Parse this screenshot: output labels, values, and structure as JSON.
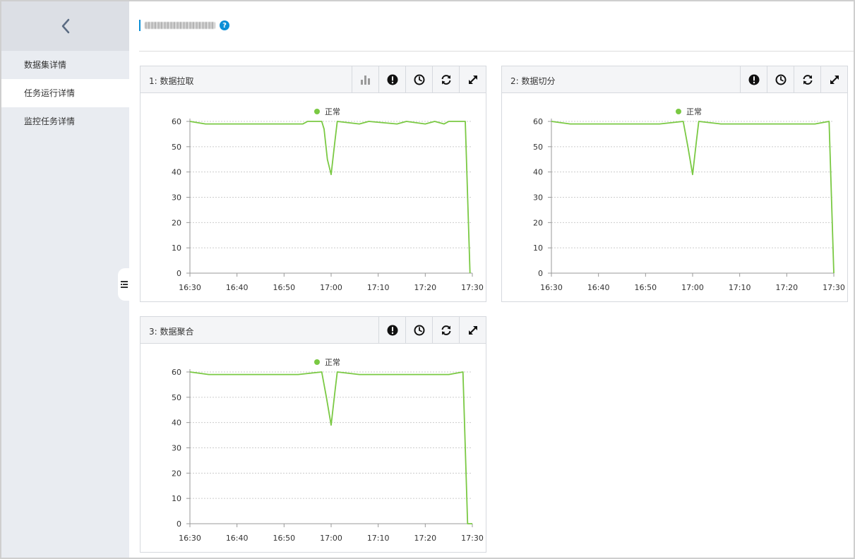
{
  "sidebar": {
    "items": [
      {
        "label": "数据集详情",
        "active": false
      },
      {
        "label": "任务运行详情",
        "active": true
      },
      {
        "label": "监控任务详情",
        "active": false
      }
    ]
  },
  "header": {
    "title": "",
    "help": "?"
  },
  "colors": {
    "accent": "#0a8fd6",
    "series": "#7ac943"
  },
  "panels": [
    {
      "title": "1: 数据拉取",
      "tools": [
        "bar-chart-icon",
        "alert-icon",
        "clock-icon",
        "refresh-icon",
        "expand-icon"
      ]
    },
    {
      "title": "2: 数据切分",
      "tools": [
        "alert-icon",
        "clock-icon",
        "refresh-icon",
        "expand-icon"
      ]
    },
    {
      "title": "3: 数据聚合",
      "tools": [
        "alert-icon",
        "clock-icon",
        "refresh-icon",
        "expand-icon"
      ]
    }
  ],
  "chart_data": [
    {
      "type": "line",
      "legend": [
        "正常"
      ],
      "xticks": [
        "16:30",
        "16:40",
        "16:50",
        "17:00",
        "17:10",
        "17:20",
        "17:30"
      ],
      "yticks": [
        0,
        10,
        20,
        30,
        40,
        50,
        60
      ],
      "ylim": [
        0,
        60
      ],
      "xlim": [
        0,
        60
      ],
      "series": [
        {
          "name": "正常",
          "x": [
            0,
            3.3,
            11,
            13.5,
            18,
            21.2,
            24,
            25,
            28,
            28.5,
            29.2,
            30,
            30.8,
            31.3,
            36,
            38,
            44,
            46,
            50,
            52,
            54,
            55,
            58.5,
            59.5
          ],
          "y": [
            60,
            59,
            59,
            59,
            59,
            59,
            59,
            60,
            60,
            57,
            45,
            39,
            52,
            60,
            59,
            60,
            59,
            60,
            59,
            60,
            59,
            60,
            60,
            0
          ]
        }
      ]
    },
    {
      "type": "line",
      "legend": [
        "正常"
      ],
      "xticks": [
        "16:30",
        "16:40",
        "16:50",
        "17:00",
        "17:10",
        "17:20",
        "17:30"
      ],
      "yticks": [
        0,
        10,
        20,
        30,
        40,
        50,
        60
      ],
      "ylim": [
        0,
        60
      ],
      "xlim": [
        0,
        60
      ],
      "series": [
        {
          "name": "正常",
          "x": [
            0,
            4,
            11,
            18,
            23,
            28,
            29,
            30,
            30.8,
            31.3,
            36,
            44,
            50,
            56,
            59,
            60
          ],
          "y": [
            60,
            59,
            59,
            59,
            59,
            60,
            50,
            39,
            52,
            60,
            59,
            59,
            59,
            59,
            60,
            0
          ]
        }
      ]
    },
    {
      "type": "line",
      "legend": [
        "正常"
      ],
      "xticks": [
        "16:30",
        "16:40",
        "16:50",
        "17:00",
        "17:10",
        "17:20",
        "17:30"
      ],
      "yticks": [
        0,
        10,
        20,
        30,
        40,
        50,
        60
      ],
      "ylim": [
        0,
        60
      ],
      "xlim": [
        0,
        60
      ],
      "series": [
        {
          "name": "正常",
          "x": [
            0,
            4,
            11,
            18,
            23,
            28,
            29,
            30,
            30.8,
            31.3,
            36,
            44,
            50,
            55,
            58,
            59,
            60
          ],
          "y": [
            60,
            59,
            59,
            59,
            59,
            60,
            50,
            39,
            52,
            60,
            59,
            59,
            59,
            59,
            60,
            0,
            0
          ]
        }
      ]
    }
  ]
}
